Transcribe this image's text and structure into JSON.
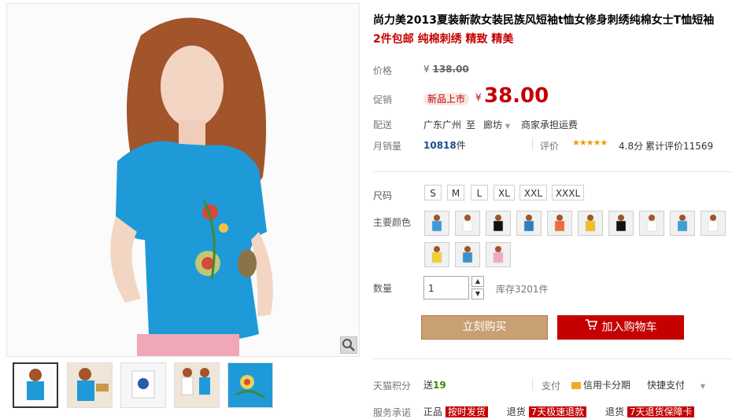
{
  "product": {
    "title": "尚力美2013夏装新款女装民族风短袖t恤女修身刺绣纯棉女士T恤短袖",
    "subtitle": "2件包邮 纯棉刺绣 精致 精美"
  },
  "price": {
    "label": "价格",
    "currency": "¥",
    "original": "138.00"
  },
  "promo": {
    "label": "促销",
    "badge": "新品上市",
    "currency": "¥",
    "price": "38.00"
  },
  "delivery": {
    "label": "配送",
    "from": "广东广州",
    "to_word": "至",
    "dest": "廊坊",
    "shipping": "商家承担运费"
  },
  "sales": {
    "label": "月销量",
    "count": "10818",
    "unit": "件",
    "rating_label": "评价",
    "rating_value": "4.8分",
    "stars": 4.8,
    "reviews": "累计评价11569"
  },
  "size": {
    "label": "尺码",
    "options": [
      "S",
      "M",
      "L",
      "XL",
      "XXL",
      "XXXL"
    ]
  },
  "color": {
    "label": "主要颜色",
    "swatches": [
      "#3a9ad9",
      "#ffffff",
      "#111111",
      "#2a7fc4",
      "#f06b3a",
      "#f0c020",
      "#111111",
      "#ffffff",
      "#3aa0d8",
      "#ffffff",
      "#f2d030",
      "#3a8fcf",
      "#f4a8c8"
    ]
  },
  "quantity": {
    "label": "数量",
    "value": "1",
    "stock": "库存3201件"
  },
  "actions": {
    "buy_now": "立刻购买",
    "add_cart": "加入购物车"
  },
  "points": {
    "label": "天猫积分",
    "prefix": "送",
    "value": "19"
  },
  "payment": {
    "label": "支付",
    "credit": "信用卡分期",
    "express": "快捷支付"
  },
  "service": {
    "label": "服务承诺",
    "items": [
      "正品",
      "按时发货",
      "退货",
      "7天极速退款",
      "退货",
      "7天退货保障卡"
    ]
  },
  "colors": {
    "accent": "#c40000",
    "buy_now": "#c8a073",
    "shirt": "#1f9ad8"
  },
  "icons": {
    "zoom": "magnifier-icon",
    "cart": "cart-icon",
    "stars": "star-icon"
  }
}
